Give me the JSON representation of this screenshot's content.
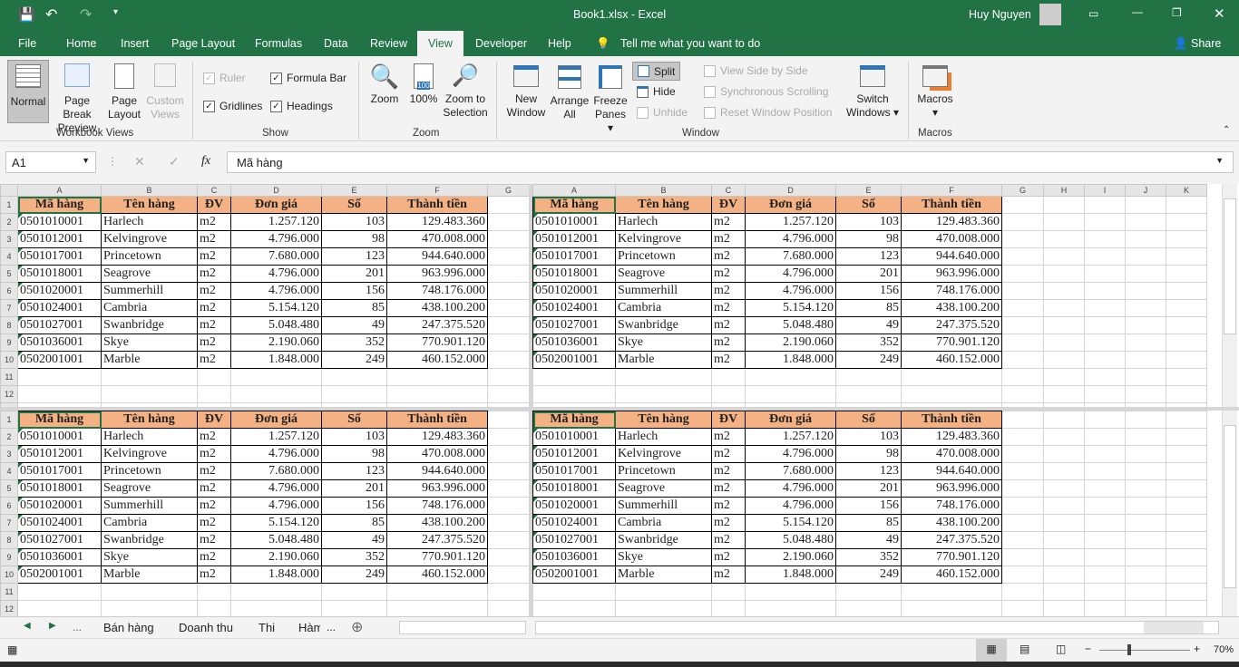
{
  "title": {
    "file": "Book1.xlsx  -  Excel",
    "user": "Huy Nguyen"
  },
  "tabs": [
    "File",
    "Home",
    "Insert",
    "Page Layout",
    "Formulas",
    "Data",
    "Review",
    "View",
    "Developer",
    "Help"
  ],
  "tell_me": "Tell me what you want to do",
  "share": "Share",
  "ribbon": {
    "normal": "Normal",
    "page_break": "Page Break",
    "page_break2": "Preview",
    "page_layout": "Page",
    "page_layout2": "Layout",
    "custom": "Custom",
    "custom2": "Views",
    "grp_views": "Workbook Views",
    "ruler": "Ruler",
    "formula_bar": "Formula Bar",
    "gridlines": "Gridlines",
    "headings": "Headings",
    "grp_show": "Show",
    "zoom": "Zoom",
    "zoom100": "100%",
    "zoom_sel": "Zoom to",
    "zoom_sel2": "Selection",
    "grp_zoom": "Zoom",
    "new_window": "New",
    "new_window2": "Window",
    "arrange": "Arrange",
    "arrange2": "All",
    "freeze": "Freeze",
    "freeze2": "Panes",
    "split": "Split",
    "hide": "Hide",
    "unhide": "Unhide",
    "side_by_side": "View Side by Side",
    "sync_scroll": "Synchronous Scrolling",
    "reset_pos": "Reset Window Position",
    "switch": "Switch",
    "switch2": "Windows",
    "grp_window": "Window",
    "macros": "Macros",
    "grp_macros": "Macros"
  },
  "namebox": "A1",
  "formula": "Mã hàng",
  "columns_left": [
    "A",
    "B",
    "C",
    "D",
    "E",
    "F",
    "G"
  ],
  "columns_right": [
    "A",
    "B",
    "C",
    "D",
    "E",
    "F",
    "G",
    "H",
    "I",
    "J",
    "K"
  ],
  "headers": [
    "Mã hàng",
    "Tên hàng",
    "ĐV",
    "Đơn giá",
    "Số",
    "Thành tiền"
  ],
  "rows": [
    [
      "0501010001",
      "Harlech",
      "m2",
      "1.257.120",
      "103",
      "129.483.360"
    ],
    [
      "0501012001",
      "Kelvingrove",
      "m2",
      "4.796.000",
      "98",
      "470.008.000"
    ],
    [
      "0501017001",
      "Princetown",
      "m2",
      "7.680.000",
      "123",
      "944.640.000"
    ],
    [
      "0501018001",
      "Seagrove",
      "m2",
      "4.796.000",
      "201",
      "963.996.000"
    ],
    [
      "0501020001",
      "Summerhill",
      "m2",
      "4.796.000",
      "156",
      "748.176.000"
    ],
    [
      "0501024001",
      "Cambria",
      "m2",
      "5.154.120",
      "85",
      "438.100.200"
    ],
    [
      "0501027001",
      "Swanbridge",
      "m2",
      "5.048.480",
      "49",
      "247.375.520"
    ],
    [
      "0501036001",
      "Skye",
      "m2",
      "2.190.060",
      "352",
      "770.901.120"
    ],
    [
      "0502001001",
      "Marble",
      "m2",
      "1.848.000",
      "249",
      "460.152.000"
    ]
  ],
  "sheets": [
    "Bán hàng",
    "Doanh thu",
    "Thi",
    "Hàm"
  ],
  "ellipsis": "...",
  "zoom_level": "70%"
}
